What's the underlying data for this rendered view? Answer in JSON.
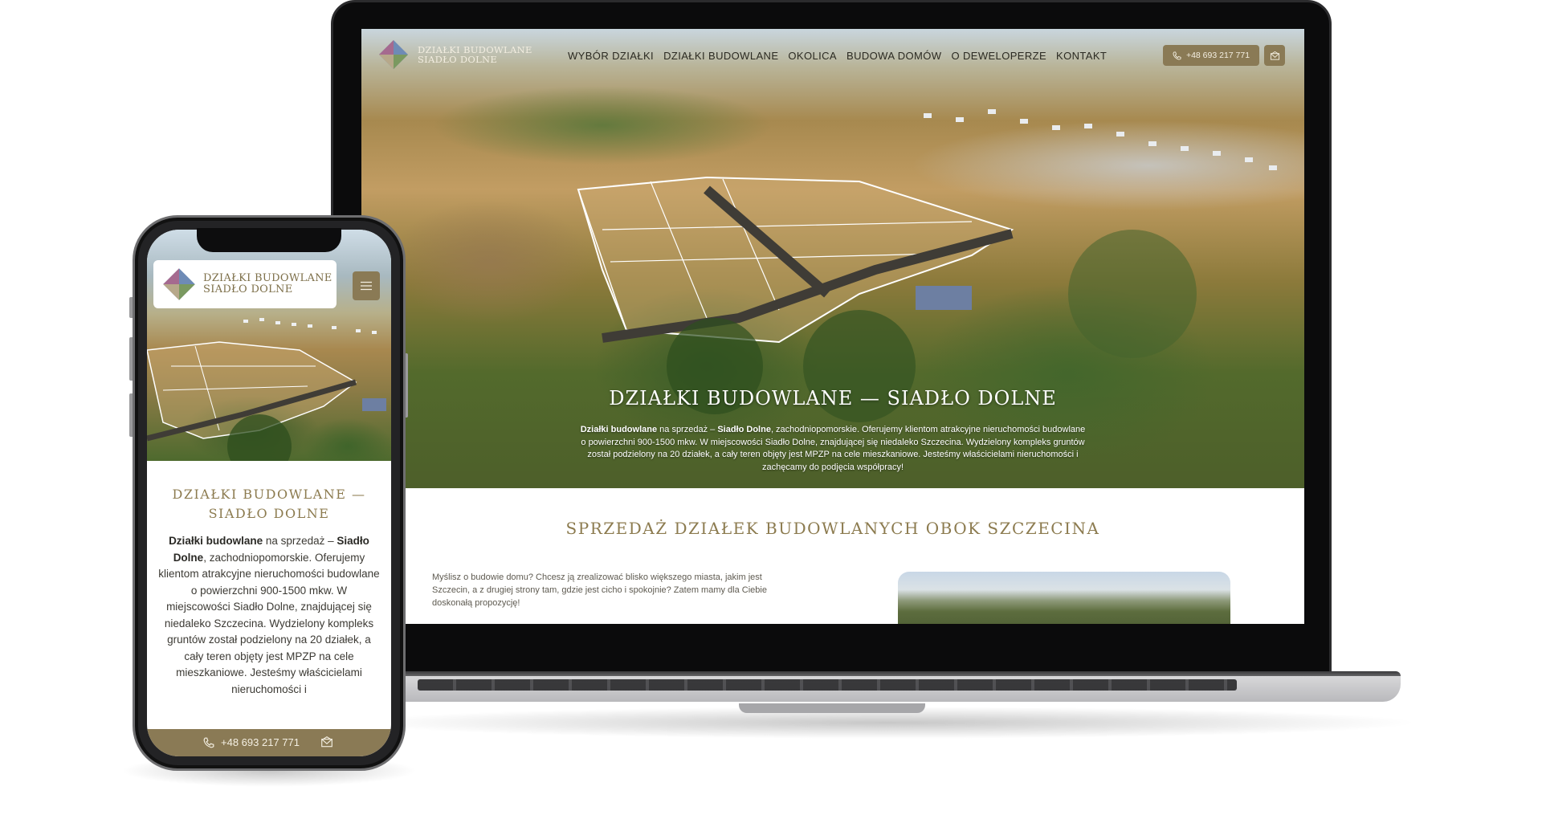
{
  "brand": {
    "line1": "DZIAŁKI BUDOWLANE",
    "line2": "SIADŁO DOLNE"
  },
  "nav": {
    "items": [
      "WYBÓR DZIAŁKI",
      "DZIAŁKI BUDOWLANE",
      "OKOLICA",
      "BUDOWA DOMÓW",
      "O DEWELOPERZE",
      "KONTAKT"
    ],
    "phone": "+48 693 217 771",
    "phone_icon": "phone-icon",
    "mail_icon": "mail-icon"
  },
  "hero": {
    "title": "DZIAŁKI BUDOWLANE — SIADŁO DOLNE",
    "copy_bold1": "Działki budowlane",
    "copy_part1": " na sprzedaż – ",
    "copy_bold2": "Siadło Dolne",
    "copy_part2": ", zachodniopomorskie. Oferujemy klientom atrakcyjne nieruchomości budowlane o powierzchni 900-1500 mkw. W miejscowości Siadło Dolne, znajdującej się niedaleko Szczecina. Wydzielony kompleks gruntów został podzielony na 20 działek, a cały teren objęty jest MPZP na cele mieszkaniowe. Jesteśmy właścicielami nieruchomości i zachęcamy do podjęcia współpracy!"
  },
  "section": {
    "title": "SPRZEDAŻ DZIAŁEK BUDOWLANYCH OBOK SZCZECINA",
    "text": "Myślisz o budowie domu? Chcesz ją zrealizować blisko większego miasta, jakim jest Szczecin, a z drugiej strony tam, gdzie jest cicho i spokojnie? Zatem mamy dla Ciebie doskonałą propozycję!"
  },
  "mobile": {
    "title_line1": "DZIAŁKI BUDOWLANE —",
    "title_line2": "SIADŁO DOLNE",
    "copy_bold1": "Działki budowlane",
    "copy_part1": " na sprzedaż – ",
    "copy_bold2": "Siadło Dolne",
    "copy_part2": ", zachodniopomorskie. Oferujemy klientom atrakcyjne nieruchomości budowlane o powierzchni 900-1500 mkw. W miejscowości Siadło Dolne, znajdującej się niedaleko Szczecina. Wydzielony kompleks gruntów został podzielony na 20 działek, a cały teren objęty jest MPZP na cele mieszkaniowe. Jesteśmy właścicielami nieruchomości i",
    "phone": "+48 693 217 771",
    "menu_icon": "hamburger-icon"
  },
  "colors": {
    "accent": "#8a7a55",
    "heading": "#8c7b4f",
    "nav_text": "#2b2a22"
  }
}
